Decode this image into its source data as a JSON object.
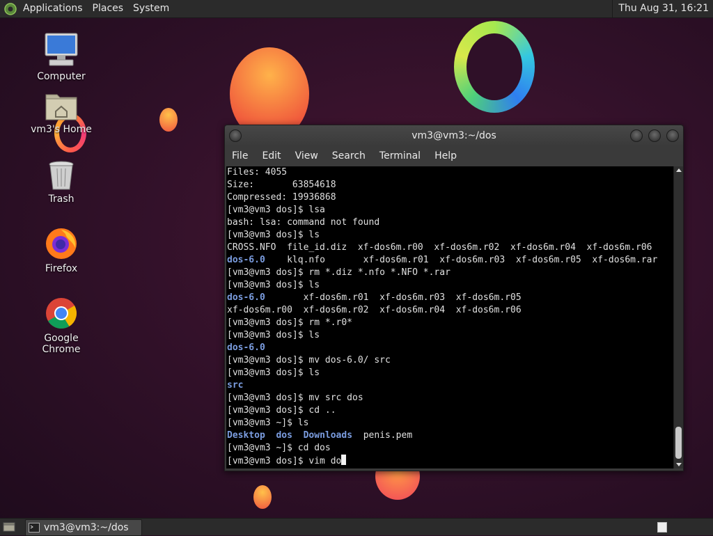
{
  "top_panel": {
    "menus": [
      "Applications",
      "Places",
      "System"
    ],
    "clock": "Thu Aug 31, 16:21"
  },
  "desktop_icons": [
    {
      "label": "Computer",
      "icon": "computer-icon"
    },
    {
      "label": "vm3's Home",
      "icon": "home-folder-icon"
    },
    {
      "label": "Trash",
      "icon": "trash-icon"
    },
    {
      "label": "Firefox",
      "icon": "firefox-icon"
    },
    {
      "label": "Google Chrome",
      "icon": "chrome-icon"
    }
  ],
  "terminal": {
    "title": "vm3@vm3:~/dos",
    "menu": [
      "File",
      "Edit",
      "View",
      "Search",
      "Terminal",
      "Help"
    ],
    "lines": [
      [
        {
          "t": "Files: 4055"
        }
      ],
      [
        {
          "t": "Size:       63854618"
        }
      ],
      [
        {
          "t": "Compressed: 19936868"
        }
      ],
      [
        {
          "t": "[vm3@vm3 dos]$ lsa"
        }
      ],
      [
        {
          "t": "bash: lsa: command not found"
        }
      ],
      [
        {
          "t": "[vm3@vm3 dos]$ ls"
        }
      ],
      [
        {
          "t": "CROSS.NFO  file_id.diz  xf-dos6m.r00  xf-dos6m.r02  xf-dos6m.r04  xf-dos6m.r06"
        }
      ],
      [
        {
          "t": "dos-6.0",
          "c": "dir"
        },
        {
          "t": "    klq.nfo       xf-dos6m.r01  xf-dos6m.r03  xf-dos6m.r05  xf-dos6m.rar"
        }
      ],
      [
        {
          "t": "[vm3@vm3 dos]$ rm *.diz *.nfo *.NFO *.rar"
        }
      ],
      [
        {
          "t": "[vm3@vm3 dos]$ ls"
        }
      ],
      [
        {
          "t": "dos-6.0",
          "c": "dir"
        },
        {
          "t": "       xf-dos6m.r01  xf-dos6m.r03  xf-dos6m.r05"
        }
      ],
      [
        {
          "t": "xf-dos6m.r00  xf-dos6m.r02  xf-dos6m.r04  xf-dos6m.r06"
        }
      ],
      [
        {
          "t": "[vm3@vm3 dos]$ rm *.r0*"
        }
      ],
      [
        {
          "t": "[vm3@vm3 dos]$ ls"
        }
      ],
      [
        {
          "t": "dos-6.0",
          "c": "dir"
        }
      ],
      [
        {
          "t": "[vm3@vm3 dos]$ mv dos-6.0/ src"
        }
      ],
      [
        {
          "t": "[vm3@vm3 dos]$ ls"
        }
      ],
      [
        {
          "t": "src",
          "c": "dir"
        }
      ],
      [
        {
          "t": "[vm3@vm3 dos]$ mv src dos"
        }
      ],
      [
        {
          "t": "[vm3@vm3 dos]$ cd .."
        }
      ],
      [
        {
          "t": "[vm3@vm3 ~]$ ls"
        }
      ],
      [
        {
          "t": "Desktop",
          "c": "dir"
        },
        {
          "t": "  "
        },
        {
          "t": "dos",
          "c": "dir"
        },
        {
          "t": "  "
        },
        {
          "t": "Downloads",
          "c": "dir"
        },
        {
          "t": "  penis.pem"
        }
      ],
      [
        {
          "t": "[vm3@vm3 ~]$ cd dos"
        }
      ],
      [
        {
          "t": "[vm3@vm3 dos]$ vim do"
        }
      ]
    ],
    "colors": {
      "directory": "#7b9de0",
      "text": "#e0e0e0",
      "background": "#000000"
    }
  },
  "bottom_panel": {
    "task_label": "vm3@vm3:~/dos"
  }
}
